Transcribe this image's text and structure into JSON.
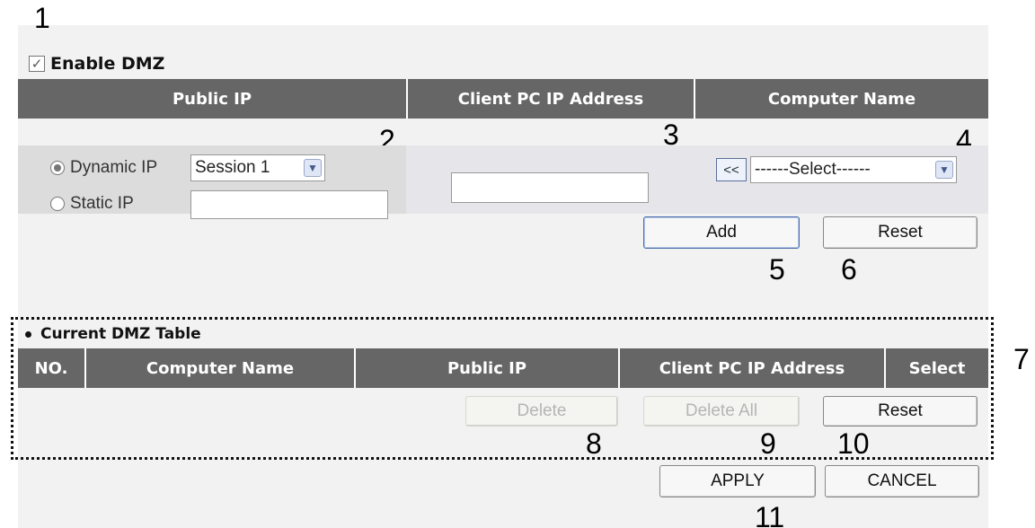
{
  "callouts": {
    "c1": "1",
    "c2": "2",
    "c3": "3",
    "c4": "4",
    "c5": "5",
    "c6": "6",
    "c7": "7",
    "c8": "8",
    "c9": "9",
    "c10": "10",
    "c11": "11"
  },
  "enable_dmz": {
    "label": "Enable DMZ",
    "checked": true
  },
  "config_table": {
    "headers": [
      "Public IP",
      "Client PC IP Address",
      "Computer Name"
    ],
    "dynamic_ip": {
      "label": "Dynamic IP",
      "selected": true,
      "session_value": "Session 1"
    },
    "static_ip": {
      "label": "Static IP",
      "selected": false,
      "value": ""
    },
    "client_ip_value": "",
    "copy_button": "<<",
    "computer_select_value": "------Select------"
  },
  "buttons": {
    "add": "Add",
    "reset_top": "Reset",
    "delete": "Delete",
    "delete_all": "Delete All",
    "reset_bottom": "Reset",
    "apply": "APPLY",
    "cancel": "CANCEL"
  },
  "dmz_table": {
    "title": "Current DMZ Table",
    "headers": [
      "NO.",
      "Computer Name",
      "Public IP",
      "Client PC IP Address",
      "Select"
    ],
    "rows": []
  },
  "colors": {
    "header_bg": "#666666",
    "panel_bg": "#f2f2f2",
    "focus_border": "#4a6ea8"
  }
}
